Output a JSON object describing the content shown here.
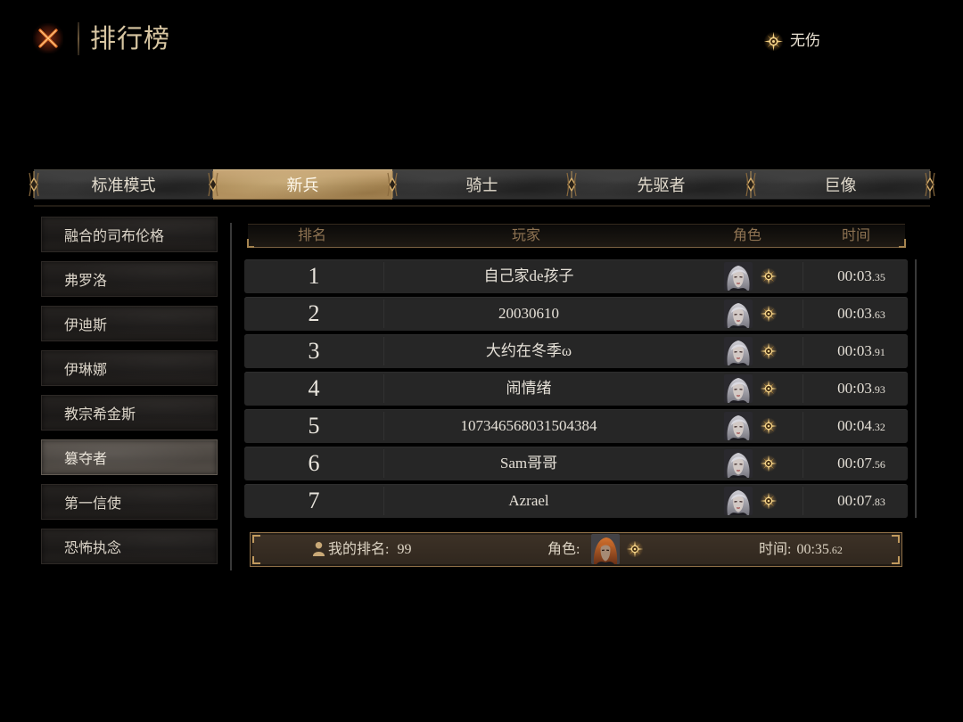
{
  "header": {
    "title": "排行榜",
    "close_icon": "close-icon",
    "mode_icon": "sun-compass-icon",
    "mode_label": "无伤"
  },
  "tabs": [
    {
      "label": "标准模式",
      "selected": false
    },
    {
      "label": "新兵",
      "selected": true
    },
    {
      "label": "骑士",
      "selected": false
    },
    {
      "label": "先驱者",
      "selected": false
    },
    {
      "label": "巨像",
      "selected": false
    }
  ],
  "bosses": [
    {
      "label": "融合的司布伦格",
      "selected": false
    },
    {
      "label": "弗罗洛",
      "selected": false
    },
    {
      "label": "伊迪斯",
      "selected": false
    },
    {
      "label": "伊琳娜",
      "selected": false
    },
    {
      "label": "教宗希金斯",
      "selected": false
    },
    {
      "label": "篡夺者",
      "selected": true
    },
    {
      "label": "第一信使",
      "selected": false
    },
    {
      "label": "恐怖执念",
      "selected": false
    }
  ],
  "table": {
    "columns": [
      "排名",
      "玩家",
      "角色",
      "时间"
    ],
    "rows": [
      {
        "rank": "1",
        "player": "自己家de孩子",
        "character_icon": "avatar-silver-hair",
        "badge_icon": "sun-compass-icon",
        "time_main": "00:03",
        "time_frac": ".35"
      },
      {
        "rank": "2",
        "player": "20030610",
        "character_icon": "avatar-silver-hair",
        "badge_icon": "sun-compass-icon",
        "time_main": "00:03",
        "time_frac": ".63"
      },
      {
        "rank": "3",
        "player": "大约在冬季ω",
        "character_icon": "avatar-silver-hair",
        "badge_icon": "sun-compass-icon",
        "time_main": "00:03",
        "time_frac": ".91"
      },
      {
        "rank": "4",
        "player": "闹情绪",
        "character_icon": "avatar-silver-hair",
        "badge_icon": "sun-compass-icon",
        "time_main": "00:03",
        "time_frac": ".93"
      },
      {
        "rank": "5",
        "player": "107346568031504384",
        "character_icon": "avatar-silver-hair",
        "badge_icon": "sun-compass-icon",
        "time_main": "00:04",
        "time_frac": ".32"
      },
      {
        "rank": "6",
        "player": "Sam哥哥",
        "character_icon": "avatar-silver-hair",
        "badge_icon": "sun-compass-icon",
        "time_main": "00:07",
        "time_frac": ".56"
      },
      {
        "rank": "7",
        "player": "Azrael",
        "character_icon": "avatar-silver-hair",
        "badge_icon": "sun-compass-icon",
        "time_main": "00:07",
        "time_frac": ".83"
      }
    ]
  },
  "my_rank": {
    "person_icon": "person-icon",
    "rank_label": "我的排名:",
    "rank_value": "99",
    "character_label": "角色:",
    "character_icon": "avatar-orange-hair",
    "badge_icon": "sun-compass-icon",
    "time_label": "时间:",
    "time_main": "00:35",
    "time_frac": ".62"
  },
  "colors": {
    "background": "#000000",
    "title_text": "#d8c6a2",
    "accent_gold": "#c19a5e",
    "selected_tab": "#b39260",
    "selected_boss": "#4a4540",
    "row_background": "#262626",
    "column_header_text": "#8e7352",
    "close_icon": "#f08a3a",
    "my_rank_bar": "#3d3227"
  }
}
